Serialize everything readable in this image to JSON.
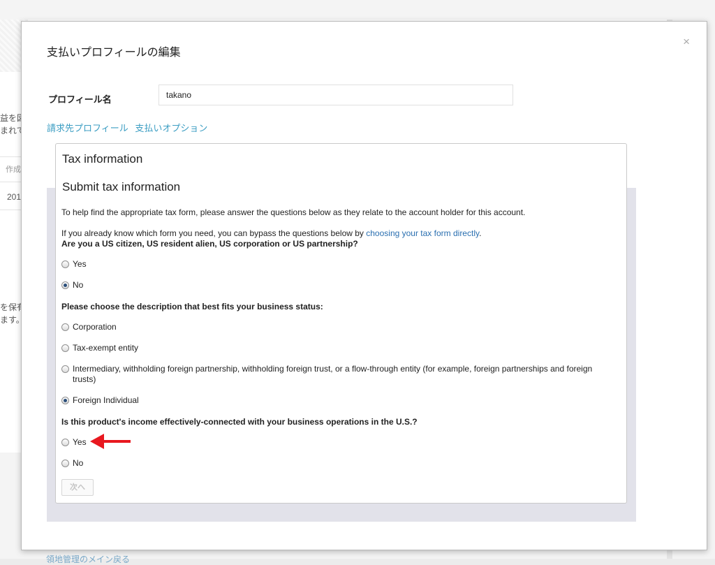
{
  "background": {
    "fragments": [
      "益を図",
      "まれて",
      "作成",
      "201",
      "を保有",
      "ます。"
    ],
    "bottom_link": "領地管理のメイン戻る"
  },
  "dialog": {
    "title": "支払いプロフィールの編集",
    "close_icon": "×",
    "profile_name_label": "プロフィール名",
    "profile_name_value": "takano",
    "tabs": [
      "請求先プロフィール",
      "支払いオプション"
    ],
    "tax": {
      "header": "Tax information",
      "subheader": "Submit tax information",
      "intro": "To help find the appropriate tax form, please answer the questions below as they relate to the account holder for this account.",
      "bypass_prefix": "If you already know which form you need, you can bypass the questions below by ",
      "bypass_link": "choosing your tax form directly",
      "bypass_suffix": ".",
      "q1": "Are you a US citizen, US resident alien, US corporation or US partnership?",
      "q1_options": [
        {
          "label": "Yes",
          "checked": false
        },
        {
          "label": "No",
          "checked": true
        }
      ],
      "q2": "Please choose the description that best fits your business status:",
      "q2_options": [
        {
          "label": "Corporation",
          "checked": false
        },
        {
          "label": "Tax-exempt entity",
          "checked": false
        },
        {
          "label": "Intermediary, withholding foreign partnership, withholding foreign trust, or a flow-through entity (for example, foreign partnerships and foreign trusts)",
          "checked": false
        },
        {
          "label": "Foreign Individual",
          "checked": true
        }
      ],
      "q3": "Is this product's income effectively-connected with your business operations in the U.S.?",
      "q3_options": [
        {
          "label": "Yes",
          "checked": false
        },
        {
          "label": "No",
          "checked": false
        }
      ],
      "next_button": "次へ"
    },
    "annotation_color": "#e8181f"
  }
}
